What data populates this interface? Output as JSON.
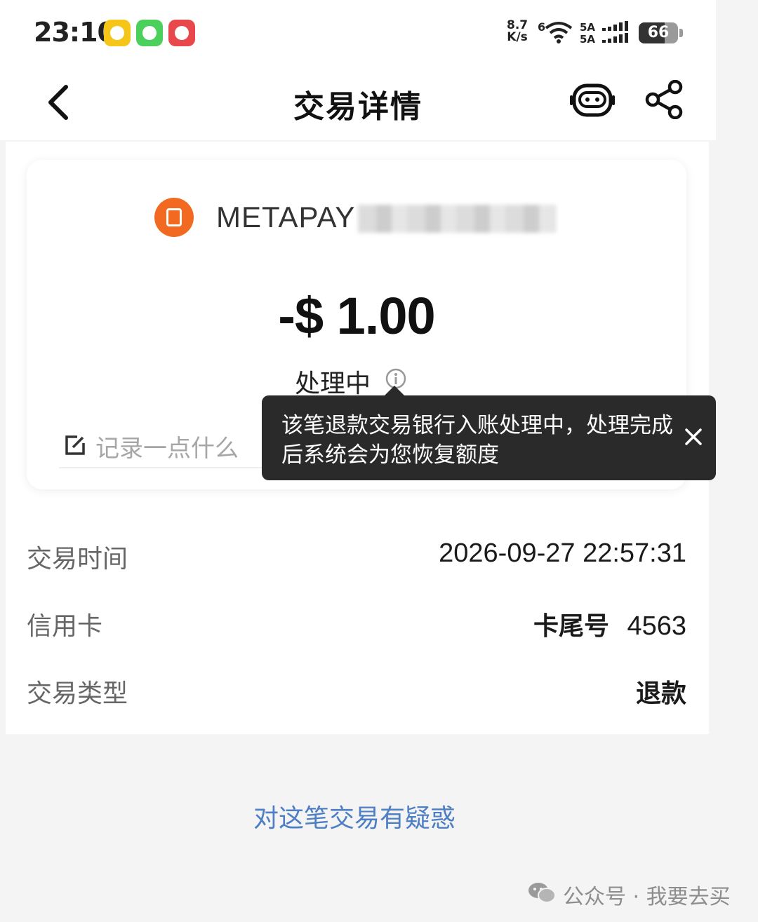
{
  "status_bar": {
    "time": "23:10",
    "app_icons": [
      {
        "name": "yellow-message-app-icon",
        "color": "#f5c518"
      },
      {
        "name": "green-wechat-app-icon",
        "color": "#4cd05c"
      },
      {
        "name": "red-app-icon",
        "color": "#e8474c"
      }
    ],
    "net_speed_value": "8.7",
    "net_speed_unit": "K/s",
    "network_type": "6",
    "signal_label_1": "5A",
    "signal_label_2": "5A",
    "battery_level": "66"
  },
  "nav": {
    "title": "交易详情"
  },
  "transaction": {
    "merchant_name": "METAPAY",
    "amount": "-$ 1.00",
    "status": "处理中",
    "note_placeholder": "记录一点什么"
  },
  "tooltip": {
    "message": "该笔退款交易银行入账处理中，处理完成后系统会为您恢复额度"
  },
  "details": [
    {
      "label": "交易时间",
      "value": "2026-09-27  22:57:31",
      "bold": false
    },
    {
      "label": "信用卡",
      "value_prefix": "卡尾号",
      "value": "4563",
      "bold": false
    },
    {
      "label": "交易类型",
      "value": "退款",
      "bold": true
    }
  ],
  "dispute_link": "对这笔交易有疑惑",
  "watermark": "公众号 · 我要去买",
  "colors": {
    "accent_link": "#4e7fc4",
    "merchant_logo": "#f26a21",
    "tooltip_bg": "#2a2a2a"
  }
}
